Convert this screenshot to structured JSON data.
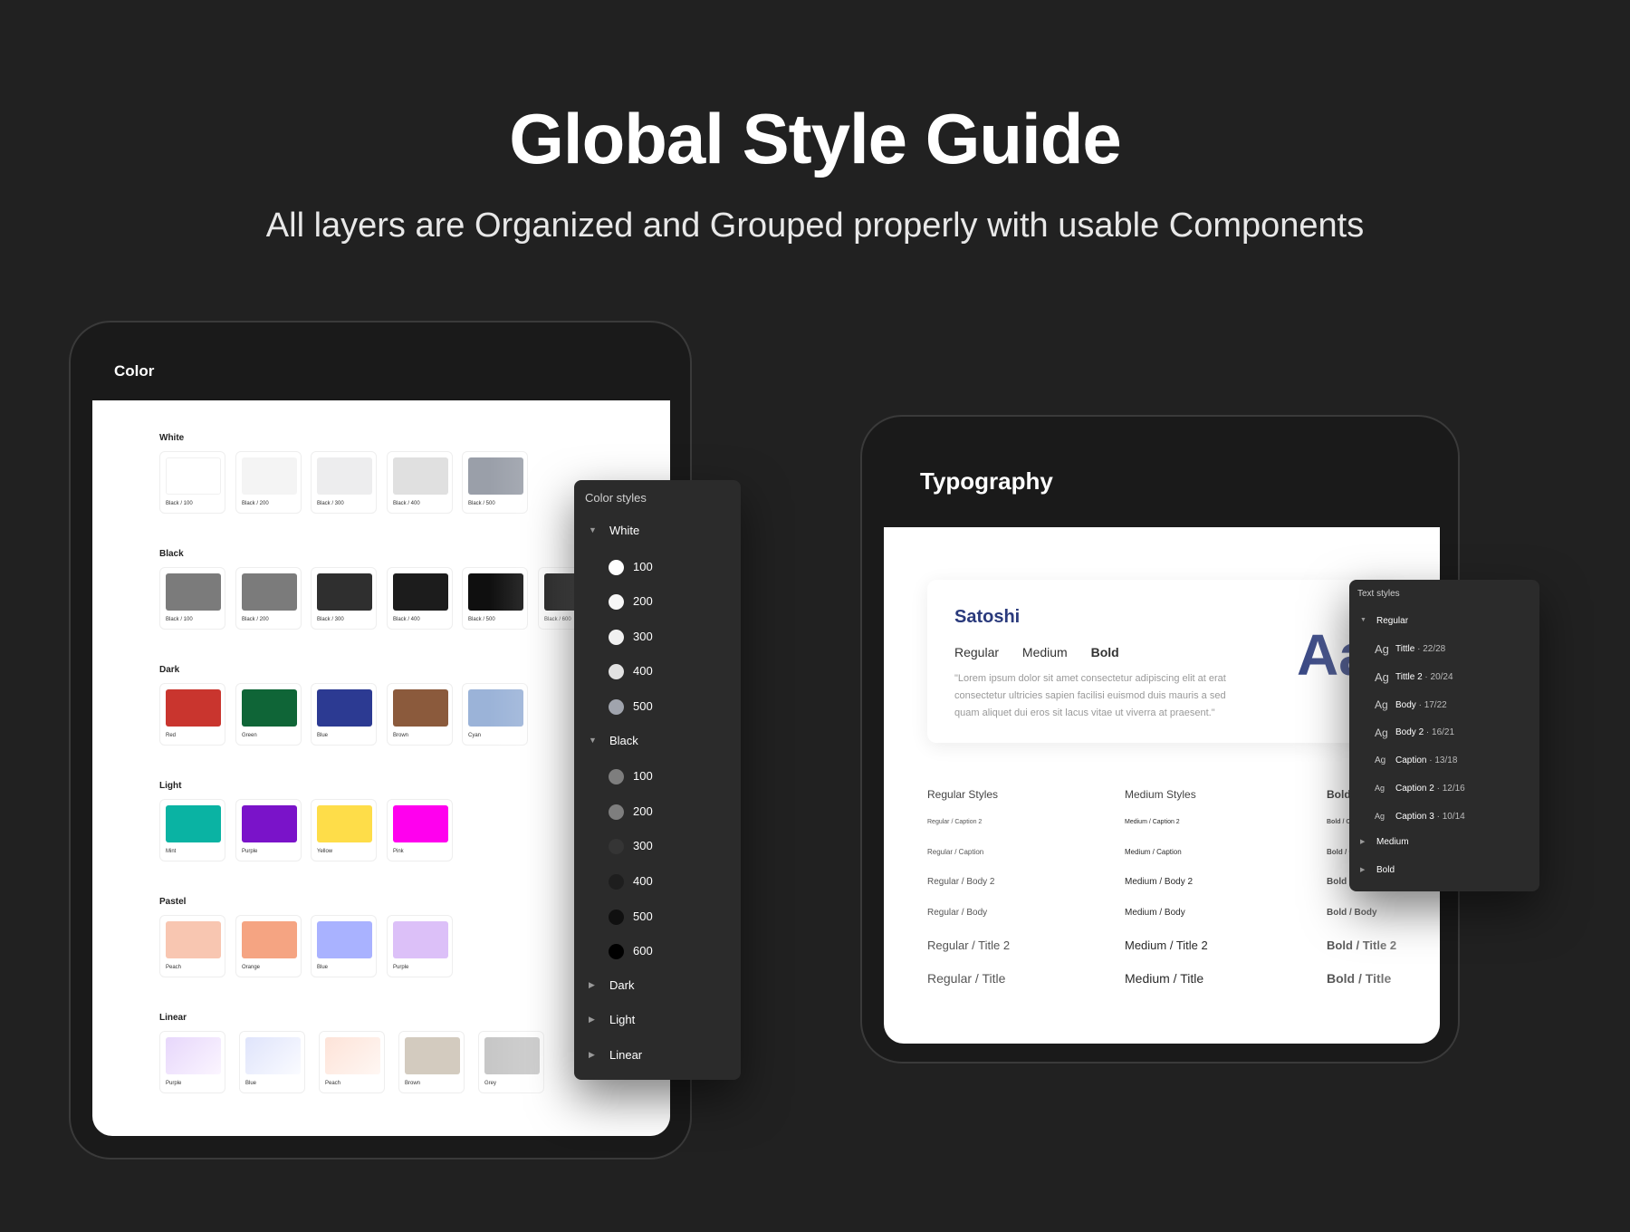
{
  "hero": {
    "title": "Global Style Guide",
    "subtitle": "All layers are Organized and Grouped properly with usable Components"
  },
  "color_frame": {
    "title": "Color",
    "groups": [
      {
        "label": "White",
        "swatches": [
          {
            "caption": "Black / 100",
            "color": "#ffffff"
          },
          {
            "caption": "Black / 200",
            "color": "#f4f4f4"
          },
          {
            "caption": "Black / 300",
            "color": "#ededee"
          },
          {
            "caption": "Black / 400",
            "color": "#e0e0e0"
          },
          {
            "caption": "Black / 500",
            "color": "#9a9fa9"
          }
        ]
      },
      {
        "label": "Black",
        "swatches": [
          {
            "caption": "Black / 100",
            "color": "#7b7b7b"
          },
          {
            "caption": "Black / 200",
            "color": "#7b7b7b"
          },
          {
            "caption": "Black / 300",
            "color": "#2f2f2f"
          },
          {
            "caption": "Black / 400",
            "color": "#1c1c1c"
          },
          {
            "caption": "Black / 500",
            "color": "#0f0f0f"
          },
          {
            "caption": "Black / 600",
            "color": "#000000"
          }
        ]
      },
      {
        "label": "Dark",
        "swatches": [
          {
            "caption": "Red",
            "color": "#c9352e"
          },
          {
            "caption": "Green",
            "color": "#0f6537"
          },
          {
            "caption": "Blue",
            "color": "#2c3a92"
          },
          {
            "caption": "Brown",
            "color": "#8b5a3c"
          },
          {
            "caption": "Cyan",
            "color": "#9bb3d8"
          }
        ]
      },
      {
        "label": "Light",
        "swatches": [
          {
            "caption": "Mint",
            "color": "#0ab3a3"
          },
          {
            "caption": "Purple",
            "color": "#7a13c9"
          },
          {
            "caption": "Yellow",
            "color": "#fedd49"
          },
          {
            "caption": "Pink",
            "color": "#ff00ee"
          }
        ]
      },
      {
        "label": "Pastel",
        "swatches": [
          {
            "caption": "Peach",
            "color": "#f8c6b1"
          },
          {
            "caption": "Orange",
            "color": "#f5a482"
          },
          {
            "caption": "Blue",
            "color": "#a9b2ff"
          },
          {
            "caption": "Purple",
            "color": "#dcc0f8"
          }
        ]
      },
      {
        "label": "Linear",
        "swatches": [
          {
            "caption": "Purple",
            "color": "linear-gradient(135deg,#e7d7fb,#fbf5ff)"
          },
          {
            "caption": "Blue",
            "color": "linear-gradient(135deg,#dfe4fb,#fafbff)"
          },
          {
            "caption": "Peach",
            "color": "linear-gradient(135deg,#fde3d8,#fff7f3)"
          },
          {
            "caption": "Brown",
            "color": "#d3cbbf"
          },
          {
            "caption": "Grey",
            "color": "#c7c7c7"
          }
        ]
      }
    ]
  },
  "color_panel": {
    "title": "Color styles",
    "rows": [
      {
        "kind": "group",
        "label": "White",
        "expanded": true
      },
      {
        "kind": "item",
        "label": "100",
        "color": "#ffffff"
      },
      {
        "kind": "item",
        "label": "200",
        "color": "#f7f7f7"
      },
      {
        "kind": "item",
        "label": "300",
        "color": "#f0f0f0"
      },
      {
        "kind": "item",
        "label": "400",
        "color": "#e2e2e2"
      },
      {
        "kind": "item",
        "label": "500",
        "color": "#a0a4ad"
      },
      {
        "kind": "group",
        "label": "Black",
        "expanded": true
      },
      {
        "kind": "item",
        "label": "100",
        "color": "#7e7e7e"
      },
      {
        "kind": "item",
        "label": "200",
        "color": "#7e7e7e"
      },
      {
        "kind": "item",
        "label": "300",
        "color": "#353535"
      },
      {
        "kind": "item",
        "label": "400",
        "color": "#1e1e1e"
      },
      {
        "kind": "item",
        "label": "500",
        "color": "#101010"
      },
      {
        "kind": "item",
        "label": "600",
        "color": "#000000"
      },
      {
        "kind": "group",
        "label": "Dark",
        "expanded": false
      },
      {
        "kind": "group",
        "label": "Light",
        "expanded": false
      },
      {
        "kind": "group",
        "label": "Linear",
        "expanded": false
      }
    ]
  },
  "type_frame": {
    "title": "Typography",
    "font_name": "Satoshi",
    "weights": [
      "Regular",
      "Medium",
      "Bold"
    ],
    "sample": "\"Lorem ipsum dolor sit amet consectetur adipiscing elit at erat consectetur ultricies sapien facilisi euismod duis mauris a sed quam aliquet dui eros sit lacus vitae ut viverra at praesent.\"",
    "aa": "Aa",
    "columns": [
      {
        "head": "Regular Styles",
        "weight": "normal",
        "items": [
          "Regular / Caption 2",
          "Regular / Caption",
          "Regular / Body 2",
          "Regular / Body",
          "Regular / Title 2",
          "Regular / Title"
        ]
      },
      {
        "head": "Medium Styles",
        "weight": "500",
        "items": [
          "Medium / Caption 2",
          "Medium / Caption",
          "Medium / Body 2",
          "Medium / Body",
          "Medium / Title 2",
          "Medium / Title"
        ]
      },
      {
        "head": "Bold Styles",
        "weight": "bold",
        "items": [
          "Bold / Caption 2",
          "Bold / Caption",
          "Bold / Body 2",
          "Bold / Body",
          "Bold / Title 2",
          "Bold / Title"
        ]
      }
    ]
  },
  "text_panel": {
    "title": "Text styles",
    "group_regular": "Regular",
    "styles": [
      {
        "name": "Tittle",
        "spec": "22/28"
      },
      {
        "name": "Tittle 2",
        "spec": "20/24"
      },
      {
        "name": "Body",
        "spec": "17/22"
      },
      {
        "name": "Body 2",
        "spec": "16/21"
      },
      {
        "name": "Caption",
        "spec": "13/18"
      },
      {
        "name": "Caption 2",
        "spec": "12/16"
      },
      {
        "name": "Caption 3",
        "spec": "10/14"
      }
    ],
    "ag": "Ag",
    "group_medium": "Medium",
    "group_bold": "Bold"
  }
}
